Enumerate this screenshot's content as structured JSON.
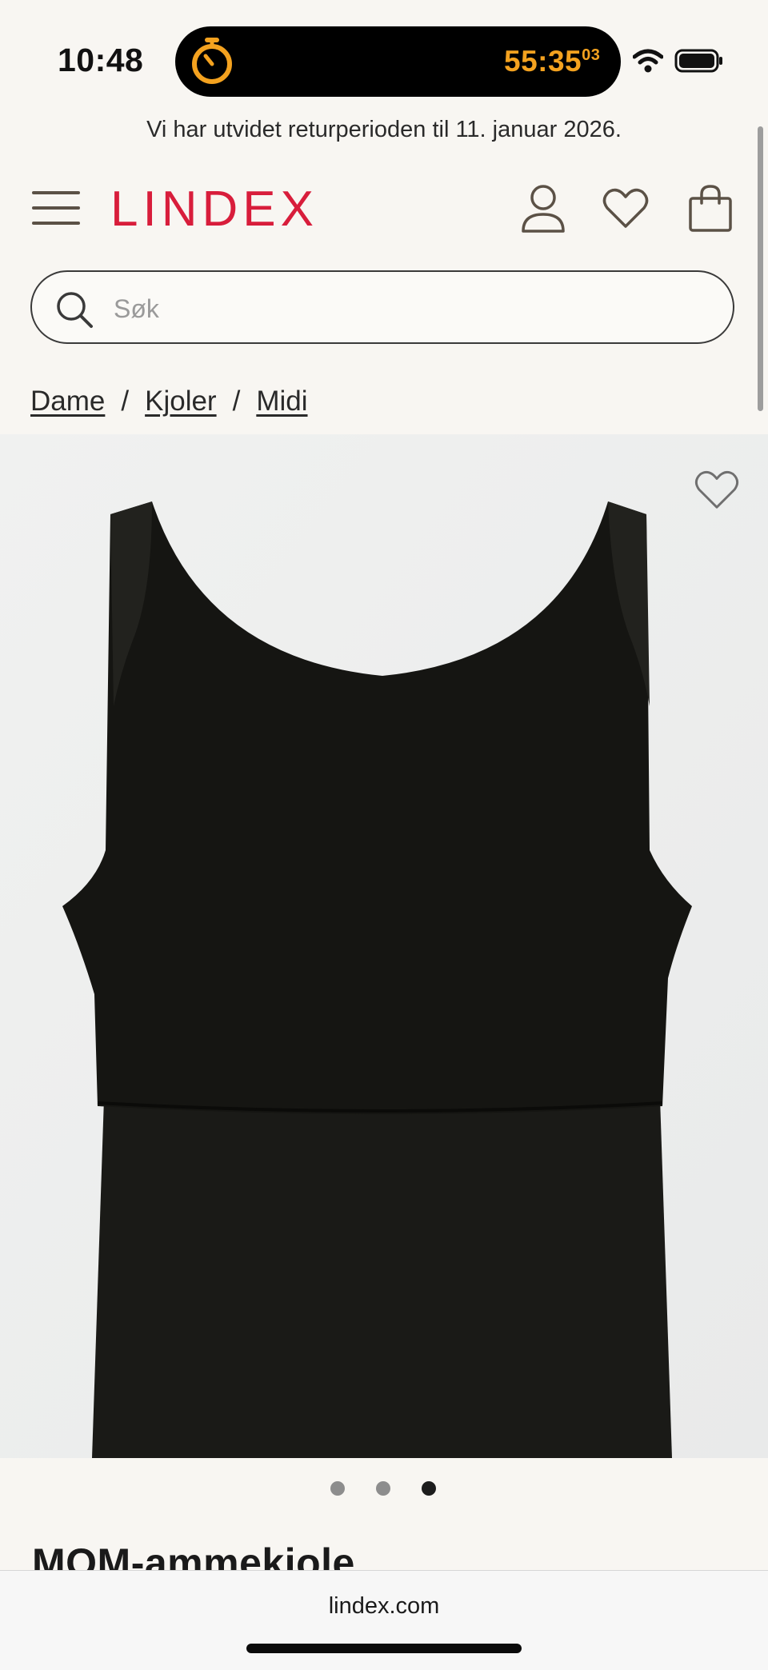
{
  "status_bar": {
    "time": "10:48",
    "timer": "55:35",
    "timer_fraction": "03",
    "icons": [
      "timer-icon",
      "wifi-icon",
      "battery-icon"
    ]
  },
  "banner": {
    "text": "Vi har utvidet returperioden til 11. januar 2026."
  },
  "header": {
    "logo": "LINDEX",
    "icons": [
      "menu-icon",
      "account-icon",
      "heart-icon",
      "shopping-bag-icon"
    ]
  },
  "search": {
    "placeholder": "Søk",
    "value": ""
  },
  "breadcrumb": [
    {
      "label": "Dame"
    },
    {
      "label": "Kjoler"
    },
    {
      "label": "Midi"
    }
  ],
  "breadcrumb_separator": "/",
  "gallery": {
    "image": "black sleeveless nursing dress",
    "dots_count": 3,
    "active_dot": 3
  },
  "product": {
    "title": "MOM-ammekjole"
  },
  "browser": {
    "url": "lindex.com"
  },
  "colors": {
    "brand": "#d81d3b",
    "timer": "#f4a21f",
    "background": "#f8f6f2"
  }
}
